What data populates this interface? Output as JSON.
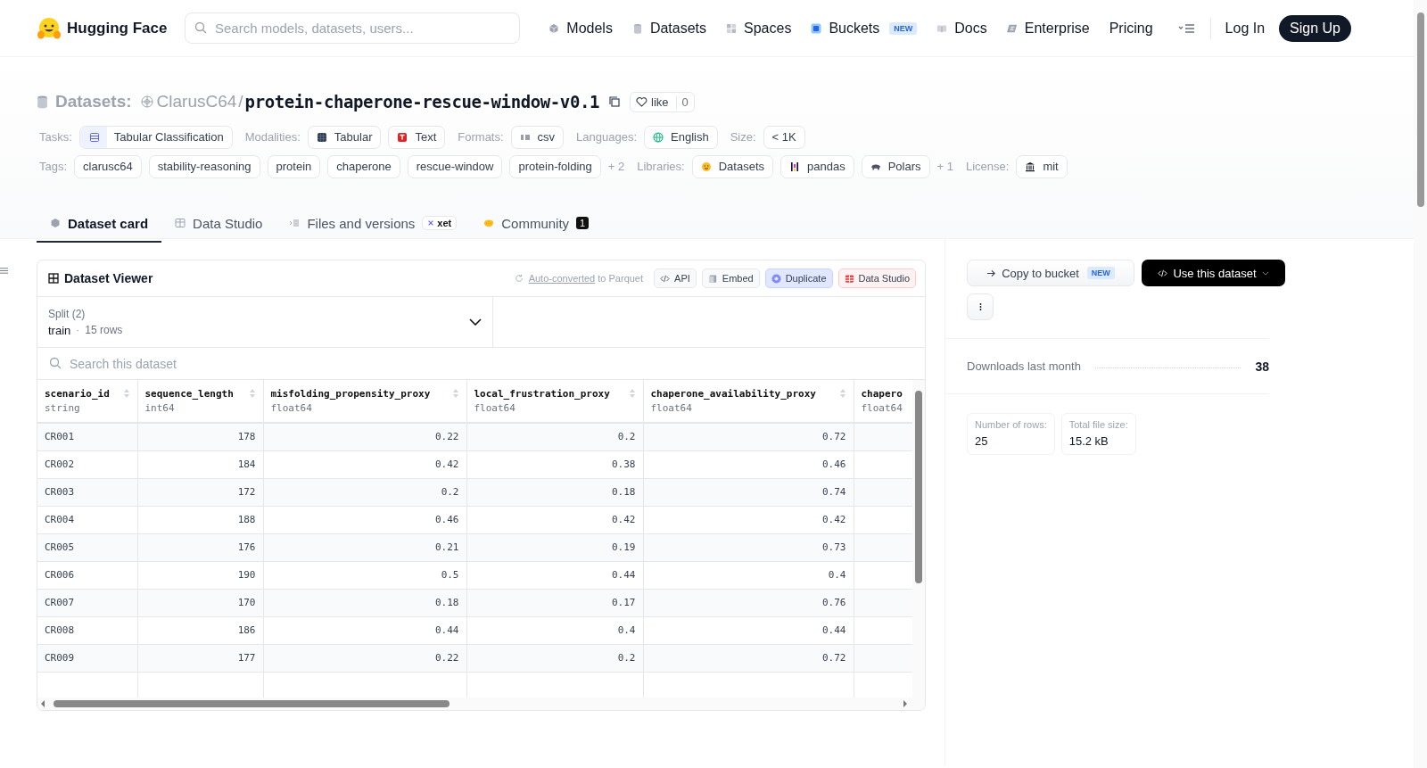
{
  "nav": {
    "logo": "Hugging Face",
    "search_placeholder": "Search models, datasets, users...",
    "items": [
      {
        "label": "Models",
        "kind": "cube"
      },
      {
        "label": "Datasets",
        "kind": "db"
      },
      {
        "label": "Spaces",
        "kind": "spaces"
      },
      {
        "label": "Buckets",
        "kind": "bucket",
        "badge": "NEW"
      },
      {
        "label": "Docs",
        "kind": "book"
      },
      {
        "label": "Enterprise",
        "kind": "enterprise"
      },
      {
        "label": "Pricing",
        "kind": "none"
      }
    ],
    "login": "Log In",
    "signup": "Sign Up"
  },
  "repo": {
    "section": "Datasets:",
    "owner": "ClarusC64",
    "separator": "/",
    "name": "protein-chaperone-rescue-window-v0.1",
    "like": "like",
    "like_count": "0"
  },
  "meta_rows": [
    {
      "groups": [
        {
          "label": "Tasks:",
          "chips": [
            {
              "text": "Tabular Classification",
              "kind": "task"
            }
          ]
        },
        {
          "label": "Modalities:",
          "chips": [
            {
              "text": "Tabular",
              "kind": "tabular"
            },
            {
              "text": "Text",
              "kind": "text"
            }
          ]
        },
        {
          "label": "Formats:",
          "chips": [
            {
              "text": "csv",
              "kind": "csv"
            }
          ]
        },
        {
          "label": "Languages:",
          "chips": [
            {
              "text": "English",
              "kind": "globe"
            }
          ]
        },
        {
          "label": "Size:",
          "chips": [
            {
              "text": "< 1K",
              "kind": "none"
            }
          ]
        }
      ]
    },
    {
      "groups": [
        {
          "label": "Tags:",
          "chips": [
            {
              "text": "clarusc64",
              "kind": "none"
            },
            {
              "text": "stability-reasoning",
              "kind": "none"
            },
            {
              "text": "protein",
              "kind": "none"
            },
            {
              "text": "chaperone",
              "kind": "none"
            },
            {
              "text": "rescue-window",
              "kind": "none"
            },
            {
              "text": "protein-folding",
              "kind": "none"
            }
          ],
          "more": "+ 2"
        },
        {
          "label": "Libraries:",
          "chips": [
            {
              "text": "Datasets",
              "kind": "hf"
            },
            {
              "text": "pandas",
              "kind": "pandas"
            },
            {
              "text": "Polars",
              "kind": "polars"
            }
          ],
          "more": "+ 1"
        },
        {
          "label": "License:",
          "chips": [
            {
              "text": "mit",
              "kind": "license"
            }
          ]
        }
      ]
    }
  ],
  "tabs": [
    {
      "label": "Dataset card",
      "kind": "card",
      "selected": true
    },
    {
      "label": "Data Studio",
      "kind": "studio",
      "selected": false
    },
    {
      "label": "Files and versions",
      "kind": "files",
      "selected": false,
      "badge": "xet"
    },
    {
      "label": "Community",
      "kind": "community",
      "selected": false,
      "count": "1"
    }
  ],
  "viewer": {
    "title": "Dataset Viewer",
    "converted_link": "Auto-converted",
    "converted_rest": "to Parquet",
    "buttons": [
      {
        "label": "API",
        "kind": "api"
      },
      {
        "label": "Embed",
        "kind": "embed"
      },
      {
        "label": "Duplicate",
        "kind": "duplicate"
      },
      {
        "label": "Data Studio",
        "kind": "studio"
      }
    ],
    "split": {
      "label": "Split (2)",
      "name": "train",
      "dot": "·",
      "rows": "15 rows"
    },
    "search_placeholder": "Search this dataset",
    "columns": [
      {
        "name": "scenario_id",
        "type": "string"
      },
      {
        "name": "sequence_length",
        "type": "int64"
      },
      {
        "name": "misfolding_propensity_proxy",
        "type": "float64"
      },
      {
        "name": "local_frustration_proxy",
        "type": "float64"
      },
      {
        "name": "chaperone_availability_proxy",
        "type": "float64"
      },
      {
        "name": "chapero",
        "type": "float64"
      }
    ],
    "rows": [
      [
        "CR001",
        "178",
        "0.22",
        "0.2",
        "0.72"
      ],
      [
        "CR002",
        "184",
        "0.42",
        "0.38",
        "0.46"
      ],
      [
        "CR003",
        "172",
        "0.2",
        "0.18",
        "0.74"
      ],
      [
        "CR004",
        "188",
        "0.46",
        "0.42",
        "0.42"
      ],
      [
        "CR005",
        "176",
        "0.21",
        "0.19",
        "0.73"
      ],
      [
        "CR006",
        "190",
        "0.5",
        "0.44",
        "0.4"
      ],
      [
        "CR007",
        "170",
        "0.18",
        "0.17",
        "0.76"
      ],
      [
        "CR008",
        "186",
        "0.44",
        "0.4",
        "0.44"
      ],
      [
        "CR009",
        "177",
        "0.22",
        "0.2",
        "0.72"
      ]
    ]
  },
  "sidebar": {
    "copy_button": "Copy to bucket",
    "copy_badge": "NEW",
    "use_button": "Use this dataset",
    "downloads_label": "Downloads last month",
    "downloads_value": "38",
    "stats": [
      {
        "label": "Number of rows:",
        "value": "25"
      },
      {
        "label": "Total file size:",
        "value": "15.2 kB"
      }
    ]
  }
}
